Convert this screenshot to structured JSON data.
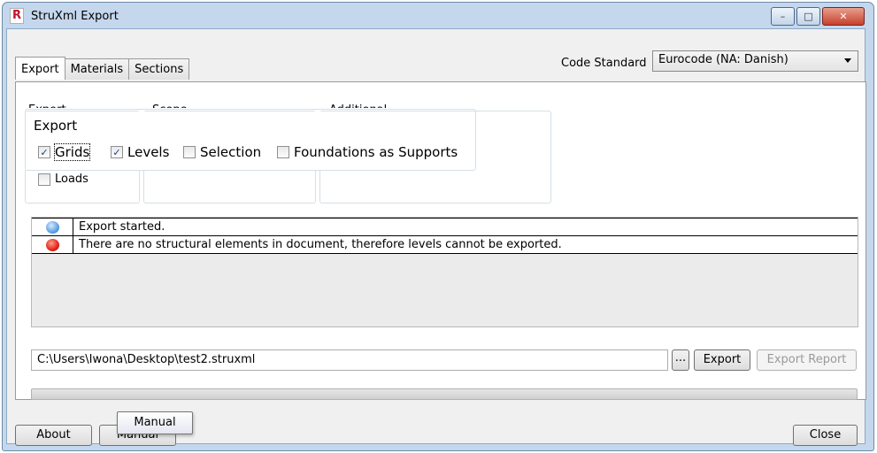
{
  "window": {
    "title": "StruXml Export",
    "app_icon_letter": "R",
    "controls": {
      "minimize": "–",
      "maximize": "□",
      "close": "✕"
    }
  },
  "tabs": [
    {
      "label": "Export",
      "active": true
    },
    {
      "label": "Materials",
      "active": false
    },
    {
      "label": "Sections",
      "active": false
    }
  ],
  "code_standard": {
    "label": "Code Standard",
    "selected": "Eurocode (NA: Danish)"
  },
  "background_groups": [
    "Export",
    "Scope",
    "Additional"
  ],
  "export_group": {
    "legend": "Export",
    "options": [
      {
        "label": "Grids",
        "checked": true
      },
      {
        "label": "Levels",
        "checked": true
      },
      {
        "label": "Selection",
        "checked": false
      },
      {
        "label": "Foundations as Supports",
        "checked": false
      }
    ],
    "loads": {
      "label": "Loads",
      "checked": false
    }
  },
  "log": [
    {
      "icon": "info-icon",
      "color": "#4a94e0",
      "message": "Export started."
    },
    {
      "icon": "error-icon",
      "color": "#e0251a",
      "message": "There are no structural elements in document, therefore levels cannot be exported."
    }
  ],
  "file_path": "C:\\Users\\Iwona\\Desktop\\test2.struxml",
  "buttons": {
    "browse": "...",
    "export": "Export",
    "export_report": "Export Report",
    "about": "About",
    "manual": "Manual",
    "close": "Close"
  },
  "tooltip": "Manual",
  "progress": 0
}
